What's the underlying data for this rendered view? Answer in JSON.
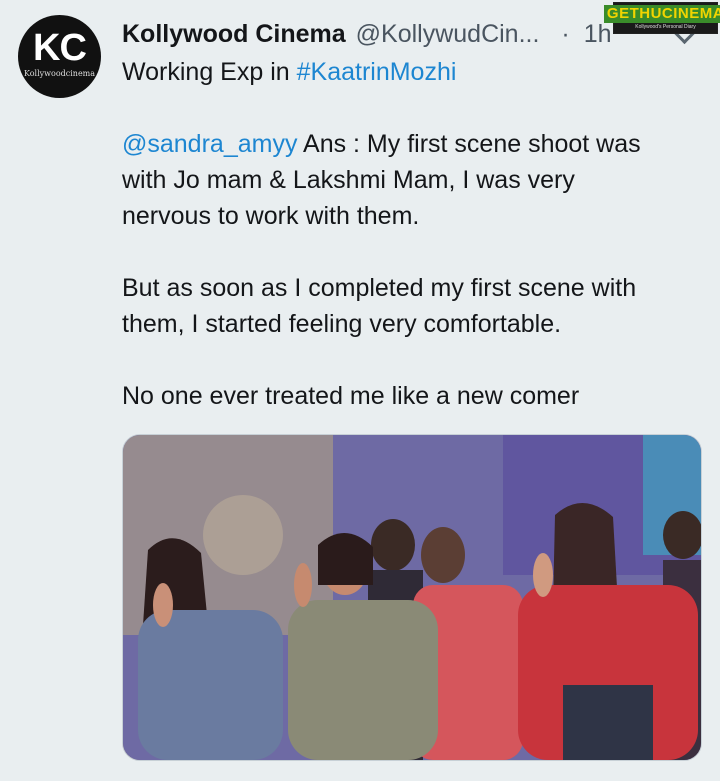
{
  "tweet": {
    "author_name": "Kollywood Cinema",
    "author_handle": "@KollywudCin...",
    "separator": "·",
    "time": "1h",
    "avatar_logo": "KC",
    "avatar_sub": "Kollywoodcinema",
    "line1_prefix": "Working Exp in ",
    "hashtag": "#KaatrinMozhi",
    "mention": "@sandra_amyy",
    "para1_a": " Ans : My first scene shoot was",
    "para1_b": "with Jo mam & Lakshmi Mam, I was very",
    "para1_c": "nervous to work with them.",
    "para2_a": "But as soon as I completed my first scene with",
    "para2_b": "them, I started feeling very comfortable.",
    "para3_a": "No one ever treated me like a new comer",
    "menu_icon": "chevron-down-icon"
  },
  "watermark": {
    "main": "GETHUCINEMA",
    "sub": "Kollywood's Personal Diary"
  },
  "colors": {
    "link": "#1d86d1",
    "background": "#e9eef0"
  }
}
